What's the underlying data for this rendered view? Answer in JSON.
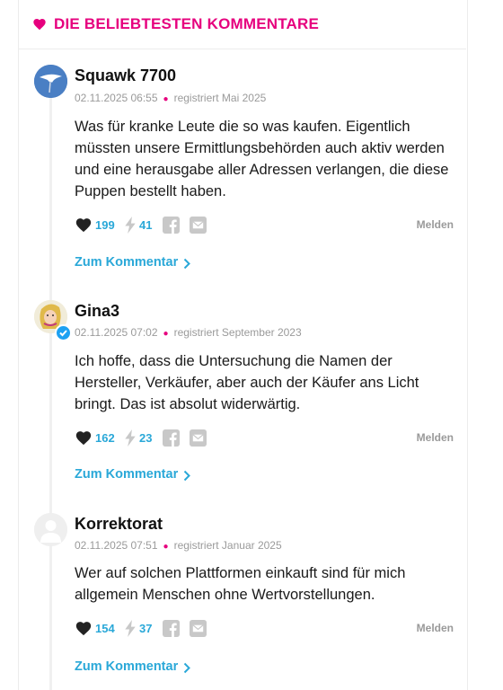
{
  "header": {
    "title": "DIE BELIEBTESTEN KOMMENTARE",
    "icon": "heart-icon",
    "accent": "#e6007e"
  },
  "link_color": "#2aa8d8",
  "comments": [
    {
      "author": "Squawk 7700",
      "date": "02.11.2025 06:55",
      "registered": "registriert Mai 2025",
      "text": "Was für kranke Leute die so was kaufen. Eigentlich müssten unsere Ermittlungsbehörden auch aktiv werden und eine herausgabe aller Adressen ver­langen, die diese Puppen bestellt haben.",
      "likes": "199",
      "dislikes": "41",
      "report": "Melden",
      "link": "Zum Kommentar",
      "verified": false
    },
    {
      "author": "Gina3",
      "date": "02.11.2025 07:02",
      "registered": "registriert September 2023",
      "text": "Ich hoffe, dass die Untersuchung die Namen der Hersteller, Verkäufer, aber auch der Käufer ans Licht bringt. Das ist absolut widerwärtig.",
      "likes": "162",
      "dislikes": "23",
      "report": "Melden",
      "link": "Zum Kommentar",
      "verified": true
    },
    {
      "author": "Korrektorat",
      "date": "02.11.2025 07:51",
      "registered": "registriert Januar 2025",
      "text": "Wer auf solchen Plattformen einkauft sind für mich allgemein Menschen ohne Wertvorstellungen.",
      "likes": "154",
      "dislikes": "37",
      "report": "Melden",
      "link": "Zum Kommentar",
      "verified": false
    }
  ]
}
